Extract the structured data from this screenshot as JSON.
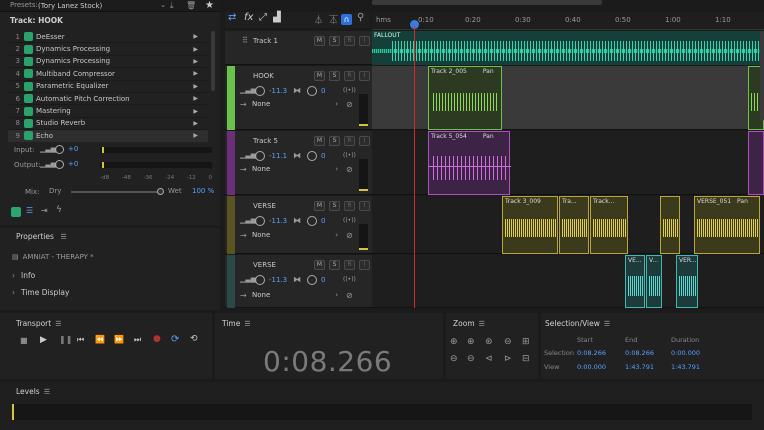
{
  "presets": {
    "label": "Presets:",
    "value": "(Tory Lanez Stock)"
  },
  "track_label": "Track: HOOK",
  "effects": [
    {
      "num": "1",
      "name": "DeEsser"
    },
    {
      "num": "2",
      "name": "Dynamics Processing"
    },
    {
      "num": "3",
      "name": "Dynamics Processing"
    },
    {
      "num": "4",
      "name": "Multiband Compressor"
    },
    {
      "num": "5",
      "name": "Parametric Equalizer"
    },
    {
      "num": "6",
      "name": "Automatic Pitch Correction"
    },
    {
      "num": "7",
      "name": "Mastering"
    },
    {
      "num": "8",
      "name": "Studio Reverb"
    },
    {
      "num": "9",
      "name": "Echo"
    }
  ],
  "io": {
    "input_label": "Input:",
    "input_val": "+0",
    "output_label": "Output:",
    "output_val": "+0"
  },
  "meter_ticks": [
    "-dB",
    "-48",
    "-36",
    "-24",
    "-12",
    "0"
  ],
  "mix": {
    "label": "Mix:",
    "dry": "Dry",
    "wet": "Wet",
    "pct": "100 %"
  },
  "properties": {
    "title": "Properties",
    "clip_name": "AMNIAT - THERAPY *",
    "sections": [
      "Info",
      "Time Display"
    ]
  },
  "ruler": {
    "unit": "hms",
    "ticks": [
      "0:10",
      "0:20",
      "0:30",
      "0:40",
      "0:50",
      "1:00",
      "1:10"
    ]
  },
  "tracks": [
    {
      "name": "Track 1",
      "m": "M",
      "s": "S",
      "r": "R",
      "i": "I",
      "color": "#3a3a3a"
    },
    {
      "name": "HOOK",
      "m": "M",
      "s": "S",
      "r": "R",
      "i": "I",
      "vol": "-11.3",
      "pan": "0",
      "route": "None",
      "color": "#6ac24a"
    },
    {
      "name": "Track 5",
      "m": "M",
      "s": "S",
      "r": "R",
      "i": "I",
      "vol": "-11.1",
      "pan": "0",
      "route": "None",
      "color": "#b24fc0"
    },
    {
      "name": "VERSE",
      "m": "M",
      "s": "S",
      "r": "R",
      "i": "I",
      "vol": "-11.3",
      "pan": "0",
      "route": "None",
      "color": "#b8a63a"
    },
    {
      "name": "VERSE",
      "m": "M",
      "s": "S",
      "r": "R",
      "i": "I",
      "vol": "-11.3",
      "pan": "0",
      "route": "None",
      "color": "#3fb8b0"
    }
  ],
  "clips": {
    "fallout": "FALLOUT",
    "hook": "Track 2_005",
    "hook_pan": "Pan",
    "t5": "Track 5_054",
    "t5_pan": "Pan",
    "v1": "Track 3_009",
    "v2": "Tra...",
    "v3": "Track...",
    "v4": "VERSE_051",
    "v4_pan": "Pan",
    "v5a": "VE...",
    "v5b": "V...",
    "v5c": "VER..."
  },
  "transport": {
    "title": "Transport"
  },
  "time": {
    "title": "Time",
    "value": "0:08.266"
  },
  "zoom": {
    "title": "Zoom"
  },
  "selection": {
    "title": "Selection/View",
    "h_start": "Start",
    "h_end": "End",
    "h_dur": "Duration",
    "sel_label": "Selection",
    "sel_start": "0:08.266",
    "sel_end": "0:08.266",
    "sel_dur": "0:00.000",
    "view_label": "View",
    "view_start": "0:00.000",
    "view_end": "1:43.791",
    "view_dur": "1:43.791"
  },
  "levels": {
    "title": "Levels"
  }
}
